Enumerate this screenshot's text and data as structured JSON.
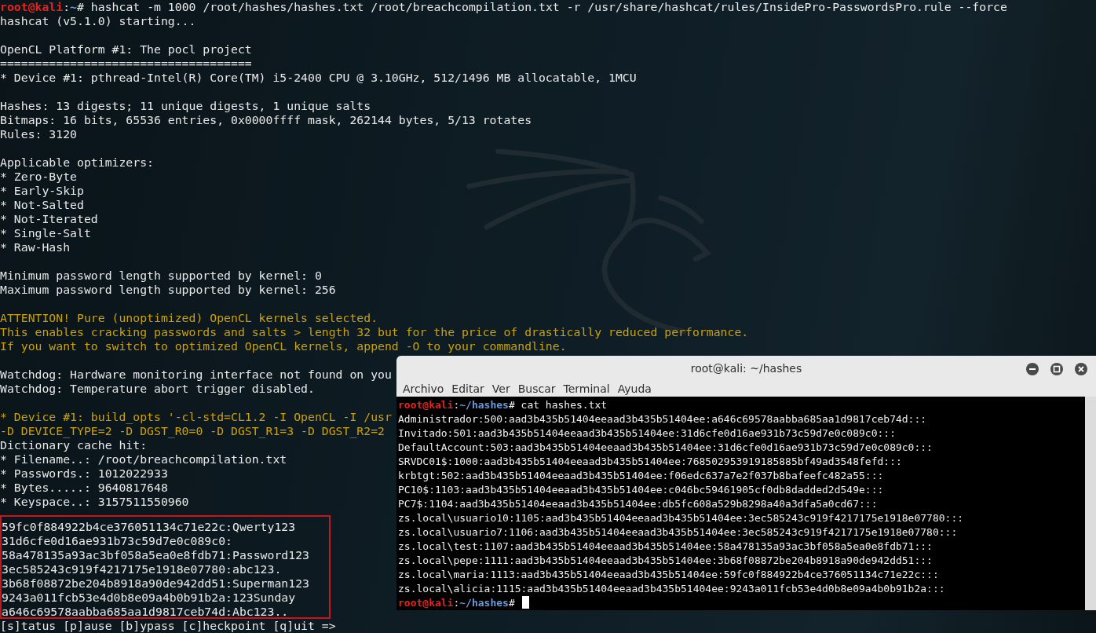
{
  "background_terminal": {
    "lines": [
      {
        "kind": "prompt",
        "user": "root@kali",
        "sep": ":",
        "path": "~",
        "symbol": "#",
        "command": " hashcat -m 1000 /root/hashes/hashes.txt /root/breachcompilation.txt -r /usr/share/hashcat/rules/InsidePro-PasswordsPro.rule --force"
      },
      {
        "kind": "normal",
        "text": "hashcat (v5.1.0) starting..."
      },
      {
        "kind": "blank"
      },
      {
        "kind": "normal",
        "text": "OpenCL Platform #1: The pocl project"
      },
      {
        "kind": "normal",
        "text": "===================================="
      },
      {
        "kind": "normal",
        "text": "* Device #1: pthread-Intel(R) Core(TM) i5-2400 CPU @ 3.10GHz, 512/1496 MB allocatable, 1MCU"
      },
      {
        "kind": "blank"
      },
      {
        "kind": "normal",
        "text": "Hashes: 13 digests; 11 unique digests, 1 unique salts"
      },
      {
        "kind": "normal",
        "text": "Bitmaps: 16 bits, 65536 entries, 0x0000ffff mask, 262144 bytes, 5/13 rotates"
      },
      {
        "kind": "normal",
        "text": "Rules: 3120"
      },
      {
        "kind": "blank"
      },
      {
        "kind": "normal",
        "text": "Applicable optimizers:"
      },
      {
        "kind": "normal",
        "text": "* Zero-Byte"
      },
      {
        "kind": "normal",
        "text": "* Early-Skip"
      },
      {
        "kind": "normal",
        "text": "* Not-Salted"
      },
      {
        "kind": "normal",
        "text": "* Not-Iterated"
      },
      {
        "kind": "normal",
        "text": "* Single-Salt"
      },
      {
        "kind": "normal",
        "text": "* Raw-Hash"
      },
      {
        "kind": "blank"
      },
      {
        "kind": "normal",
        "text": "Minimum password length supported by kernel: 0"
      },
      {
        "kind": "normal",
        "text": "Maximum password length supported by kernel: 256"
      },
      {
        "kind": "blank"
      },
      {
        "kind": "warning",
        "text": "ATTENTION! Pure (unoptimized) OpenCL kernels selected."
      },
      {
        "kind": "warning",
        "text": "This enables cracking passwords and salts > length 32 but for the price of drastically reduced performance."
      },
      {
        "kind": "warning",
        "text": "If you want to switch to optimized OpenCL kernels, append -O to your commandline."
      },
      {
        "kind": "blank"
      },
      {
        "kind": "normal",
        "text": "Watchdog: Hardware monitoring interface not found on you"
      },
      {
        "kind": "normal",
        "text": "Watchdog: Temperature abort trigger disabled."
      },
      {
        "kind": "blank"
      },
      {
        "kind": "warning",
        "text": "* Device #1: build_opts '-cl-std=CL1.2 -I OpenCL -I /usr"
      },
      {
        "kind": "warning",
        "text": "-D DEVICE_TYPE=2 -D DGST_R0=0 -D DGST_R1=3 -D DGST_R2=2"
      },
      {
        "kind": "normal",
        "text": "Dictionary cache hit:"
      },
      {
        "kind": "normal",
        "text": "* Filename..: /root/breachcompilation.txt"
      },
      {
        "kind": "normal",
        "text": "* Passwords.: 1012022933"
      },
      {
        "kind": "normal",
        "text": "* Bytes.....: 9640817648"
      },
      {
        "kind": "normal",
        "text": "* Keyspace..: 3157511550960"
      }
    ],
    "cracked": [
      "59fc0f884922b4ce376051134c71e22c:Qwerty123",
      "31d6cfe0d16ae931b73c59d7e0c089c0:",
      "58a478135a93ac3bf058a5ea0e8fdb71:Password123",
      "3ec585243c919f4217175e1918e07780:abc123.",
      "3b68f08872be204b8918a90de942dd51:Superman123",
      "9243a011fcb53e4d0b8e09a4b0b91b2a:123Sunday",
      "a646c69578aabba685aa1d9817ceb74d:Abc123.."
    ],
    "status_line": "[s]tatus [p]ause [b]ypass [c]heckpoint [q]uit =>"
  },
  "window": {
    "title": "root@kali: ~/hashes",
    "menu": [
      "Archivo",
      "Editar",
      "Ver",
      "Buscar",
      "Terminal",
      "Ayuda"
    ],
    "lines": [
      {
        "kind": "prompt",
        "user": "root@kali",
        "sep": ":",
        "path": "~/hashes",
        "symbol": "#",
        "command": " cat hashes.txt"
      },
      {
        "kind": "normal",
        "text": "Administrador:500:aad3b435b51404eeaad3b435b51404ee:a646c69578aabba685aa1d9817ceb74d:::"
      },
      {
        "kind": "normal",
        "text": "Invitado:501:aad3b435b51404eeaad3b435b51404ee:31d6cfe0d16ae931b73c59d7e0c089c0:::"
      },
      {
        "kind": "normal",
        "text": "DefaultAccount:503:aad3b435b51404eeaad3b435b51404ee:31d6cfe0d16ae931b73c59d7e0c089c0:::"
      },
      {
        "kind": "normal",
        "text": "SRVDC01$:1000:aad3b435b51404eeaad3b435b51404ee:768502953919185885bf49ad3548fefd:::"
      },
      {
        "kind": "normal",
        "text": "krbtgt:502:aad3b435b51404eeaad3b435b51404ee:f06edc637a7e2f037b8bafeefc482a55:::"
      },
      {
        "kind": "normal",
        "text": "PC10$:1103:aad3b435b51404eeaad3b435b51404ee:c046bc59461905cf0db8dadded2d549e:::"
      },
      {
        "kind": "normal",
        "text": "PC7$:1104:aad3b435b51404eeaad3b435b51404ee:db5fc608a529b8298a40a3dfa5a0cd67:::"
      },
      {
        "kind": "normal",
        "text": "zs.local\\usuario10:1105:aad3b435b51404eeaad3b435b51404ee:3ec585243c919f4217175e1918e07780:::"
      },
      {
        "kind": "normal",
        "text": "zs.local\\usuario7:1106:aad3b435b51404eeaad3b435b51404ee:3ec585243c919f4217175e1918e07780:::"
      },
      {
        "kind": "normal",
        "text": "zs.local\\test:1107:aad3b435b51404eeaad3b435b51404ee:58a478135a93ac3bf058a5ea0e8fdb71:::"
      },
      {
        "kind": "normal",
        "text": "zs.local\\pepe:1111:aad3b435b51404eeaad3b435b51404ee:3b68f08872be204b8918a90de942dd51:::"
      },
      {
        "kind": "normal",
        "text": "zs.local\\maria:1113:aad3b435b51404eeaad3b435b51404ee:59fc0f884922b4ce376051134c71e22c:::"
      },
      {
        "kind": "normal",
        "text": "zs.local\\alicia:1115:aad3b435b51404eeaad3b435b51404ee:9243a011fcb53e4d0b8e09a4b0b91b2a:::"
      },
      {
        "kind": "prompt",
        "user": "root@kali",
        "sep": ":",
        "path": "~/hashes",
        "symbol": "#",
        "cursor": true
      }
    ]
  }
}
